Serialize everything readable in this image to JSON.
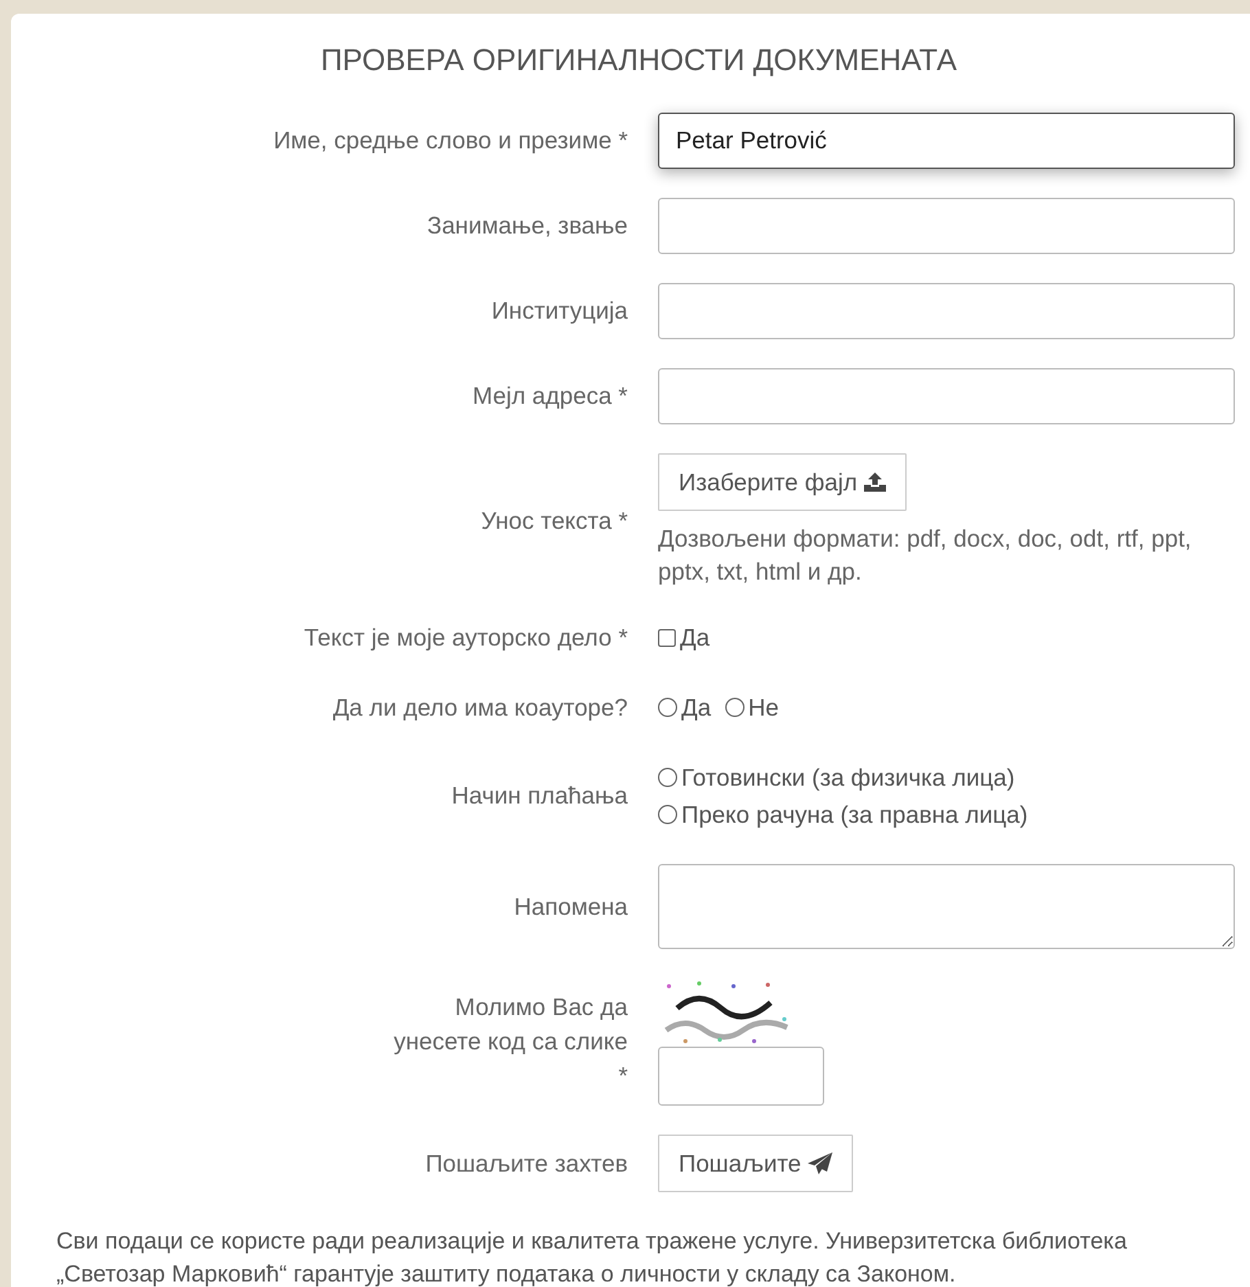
{
  "title": "ПРОВЕРА ОРИГИНАЛНОСТИ ДОКУМЕНАТА",
  "fields": [
    {
      "kind": "text",
      "label": "Име, средње слово и презиме *",
      "value": "Petar Petrović",
      "focused": true
    },
    {
      "kind": "text",
      "label": "Занимање, звање",
      "focused": false
    },
    {
      "kind": "text",
      "label": "Институција",
      "focused": false
    },
    {
      "kind": "text",
      "label": "Мејл адреса *",
      "focused": false
    },
    {
      "kind": "file",
      "label": "Унос текста *",
      "button": "Изаберите фајл",
      "hint": "Дозвољени формати: pdf, docx, doc, odt, rtf, ppt, pptx, txt, html и др."
    },
    {
      "kind": "checkbox",
      "label": "Текст је моје ауторско дело *",
      "options": [
        {
          "label": "Да",
          "checked": false
        }
      ]
    },
    {
      "kind": "radio",
      "label": "Да ли дело има коауторе?",
      "stacked": false,
      "options": [
        {
          "label": "Да",
          "selected": false
        },
        {
          "label": "Не",
          "selected": false
        }
      ]
    },
    {
      "kind": "radio",
      "label": "Начин плаћања",
      "stacked": true,
      "options": [
        {
          "label": "Готовински (за физичка лица)",
          "selected": false
        },
        {
          "label": "Преко рачуна (за правна лица)",
          "selected": false
        }
      ]
    },
    {
      "kind": "textarea",
      "label": "Напомена"
    },
    {
      "kind": "captcha",
      "label": "Молимо Вас да унесете код са слике *"
    },
    {
      "kind": "submit",
      "label": "Пошаљите захтев",
      "button": "Пошаљите"
    }
  ],
  "footer": "Сви подаци се користе ради реализације и квалитета тражене услуге. Универзитетска библиотека „Светозар Марковић“ гарантује заштиту података о личности у складу са Законом."
}
